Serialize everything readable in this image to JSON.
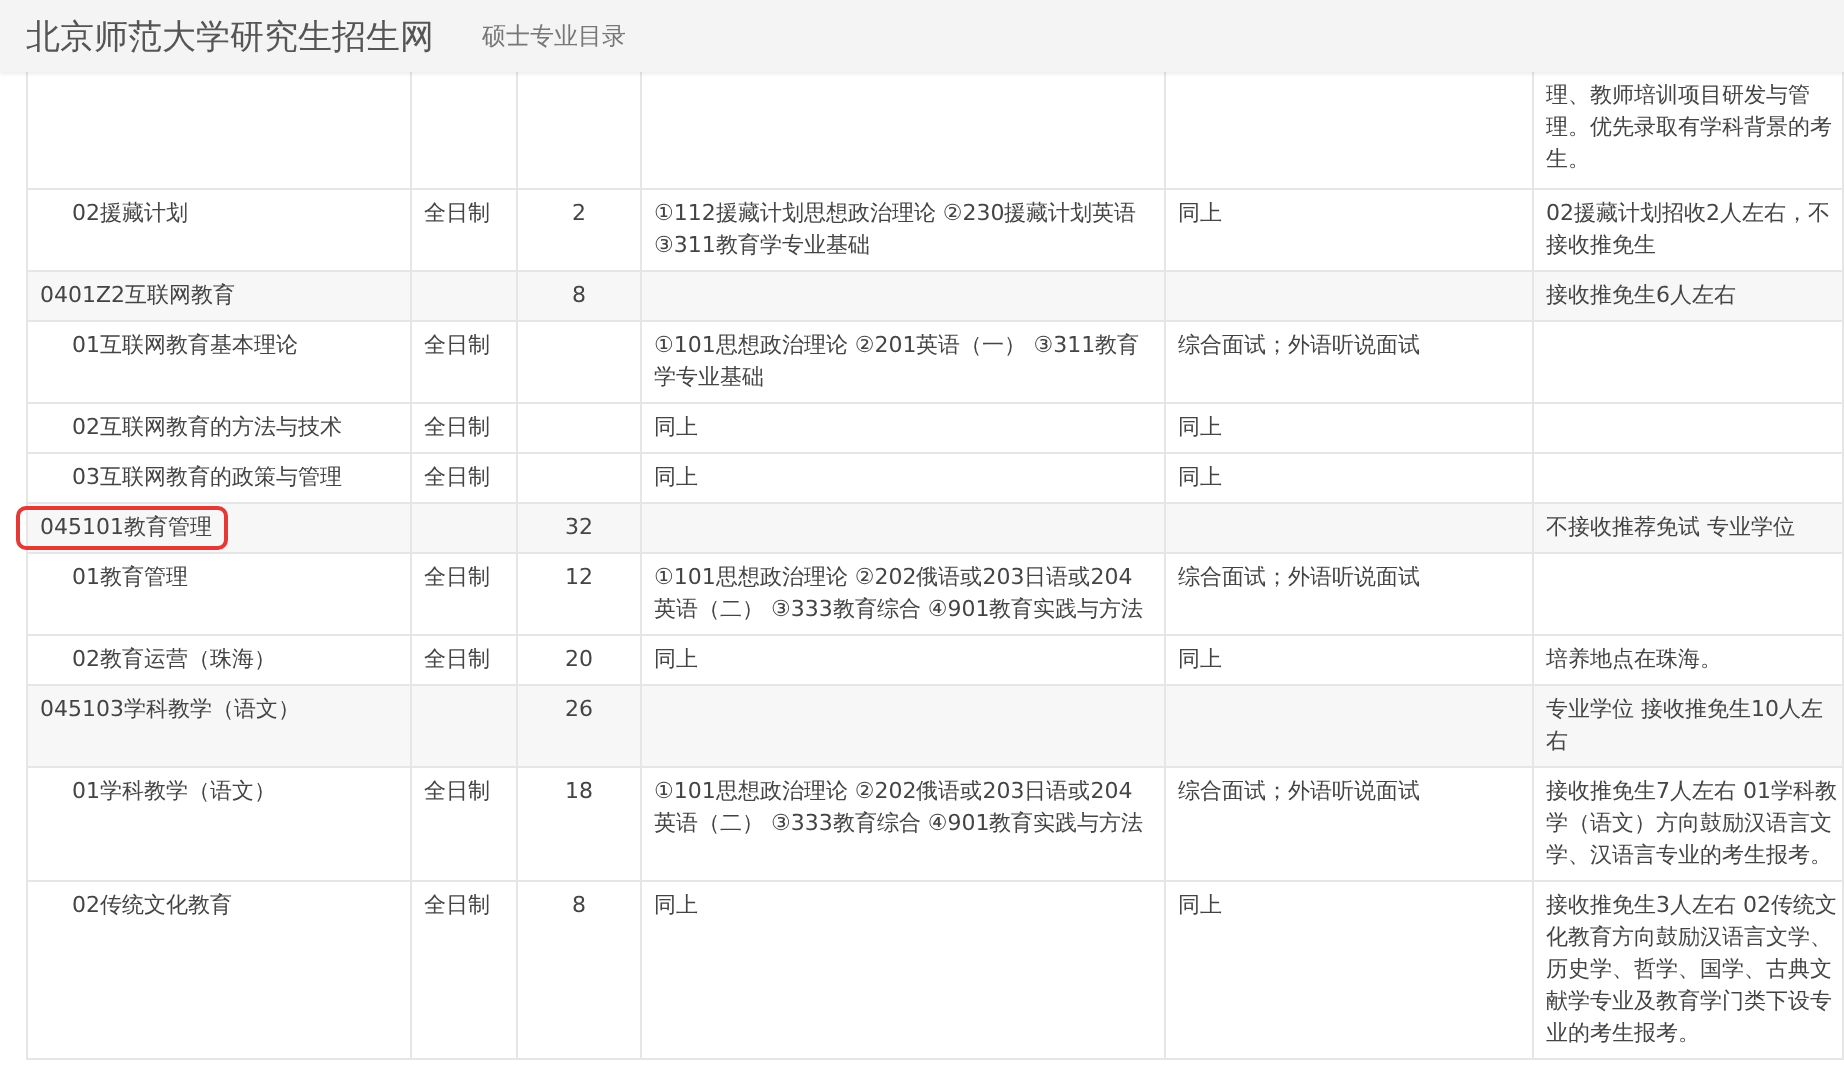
{
  "header": {
    "site_title": "北京师范大学研究生招生网",
    "page_title": "硕士专业目录"
  },
  "table": {
    "rows": [
      {
        "kind": "direction",
        "column_6": "理、教师培训项目研发与管理。优先录取有学科背景的考生。"
      },
      {
        "kind": "direction",
        "highlighted": false,
        "column_1": "02援藏计划",
        "column_2": "全日制",
        "column_3": "2",
        "column_4": "①112援藏计划思想政治理论 ②230援藏计划英语 ③311教育学专业基础",
        "column_5": "同上",
        "column_6": "02援藏计划招收2人左右，不接收推免生"
      },
      {
        "kind": "major",
        "highlighted": false,
        "column_1": "0401Z2互联网教育",
        "column_3": "8",
        "column_6": "接收推免生6人左右"
      },
      {
        "kind": "direction",
        "highlighted": false,
        "column_1": "01互联网教育基本理论",
        "column_2": "全日制",
        "column_4": "①101思想政治理论 ②201英语（一） ③311教育学专业基础",
        "column_5": "综合面试；外语听说面试"
      },
      {
        "kind": "direction",
        "highlighted": false,
        "column_1": "02互联网教育的方法与技术",
        "column_2": "全日制",
        "column_4": "同上",
        "column_5": "同上"
      },
      {
        "kind": "direction",
        "highlighted": false,
        "column_1": "03互联网教育的政策与管理",
        "column_2": "全日制",
        "column_4": "同上",
        "column_5": "同上"
      },
      {
        "kind": "major",
        "highlighted": true,
        "column_1": "045101教育管理",
        "column_3": "32",
        "column_6": "不接收推荐免试 专业学位"
      },
      {
        "kind": "direction",
        "highlighted": false,
        "column_1": "01教育管理",
        "column_2": "全日制",
        "column_3": "12",
        "column_4": "①101思想政治理论 ②202俄语或203日语或204英语（二） ③333教育综合 ④901教育实践与方法",
        "column_5": "综合面试；外语听说面试"
      },
      {
        "kind": "direction",
        "highlighted": false,
        "column_1": "02教育运营（珠海）",
        "column_2": "全日制",
        "column_3": "20",
        "column_4": "同上",
        "column_5": "同上",
        "column_6": "培养地点在珠海。"
      },
      {
        "kind": "major",
        "highlighted": false,
        "column_1": "045103学科教学（语文）",
        "column_3": "26",
        "column_6": "专业学位 接收推免生10人左右"
      },
      {
        "kind": "direction",
        "highlighted": false,
        "column_1": "01学科教学（语文）",
        "column_2": "全日制",
        "column_3": "18",
        "column_4": "①101思想政治理论 ②202俄语或203日语或204英语（二） ③333教育综合 ④901教育实践与方法",
        "column_5": "综合面试；外语听说面试",
        "column_6": "接收推免生7人左右 01学科教学（语文）方向鼓励汉语言文学、汉语言专业的考生报考。"
      },
      {
        "kind": "direction",
        "highlighted": false,
        "column_1": "02传统文化教育",
        "column_2": "全日制",
        "column_3": "8",
        "column_4": "同上",
        "column_5": "同上",
        "column_6": "接收推免生3人左右 02传统文化教育方向鼓励汉语言文学、历史学、哲学、国学、古典文献学专业及教育学门类下设专业的考生报考。"
      }
    ]
  }
}
